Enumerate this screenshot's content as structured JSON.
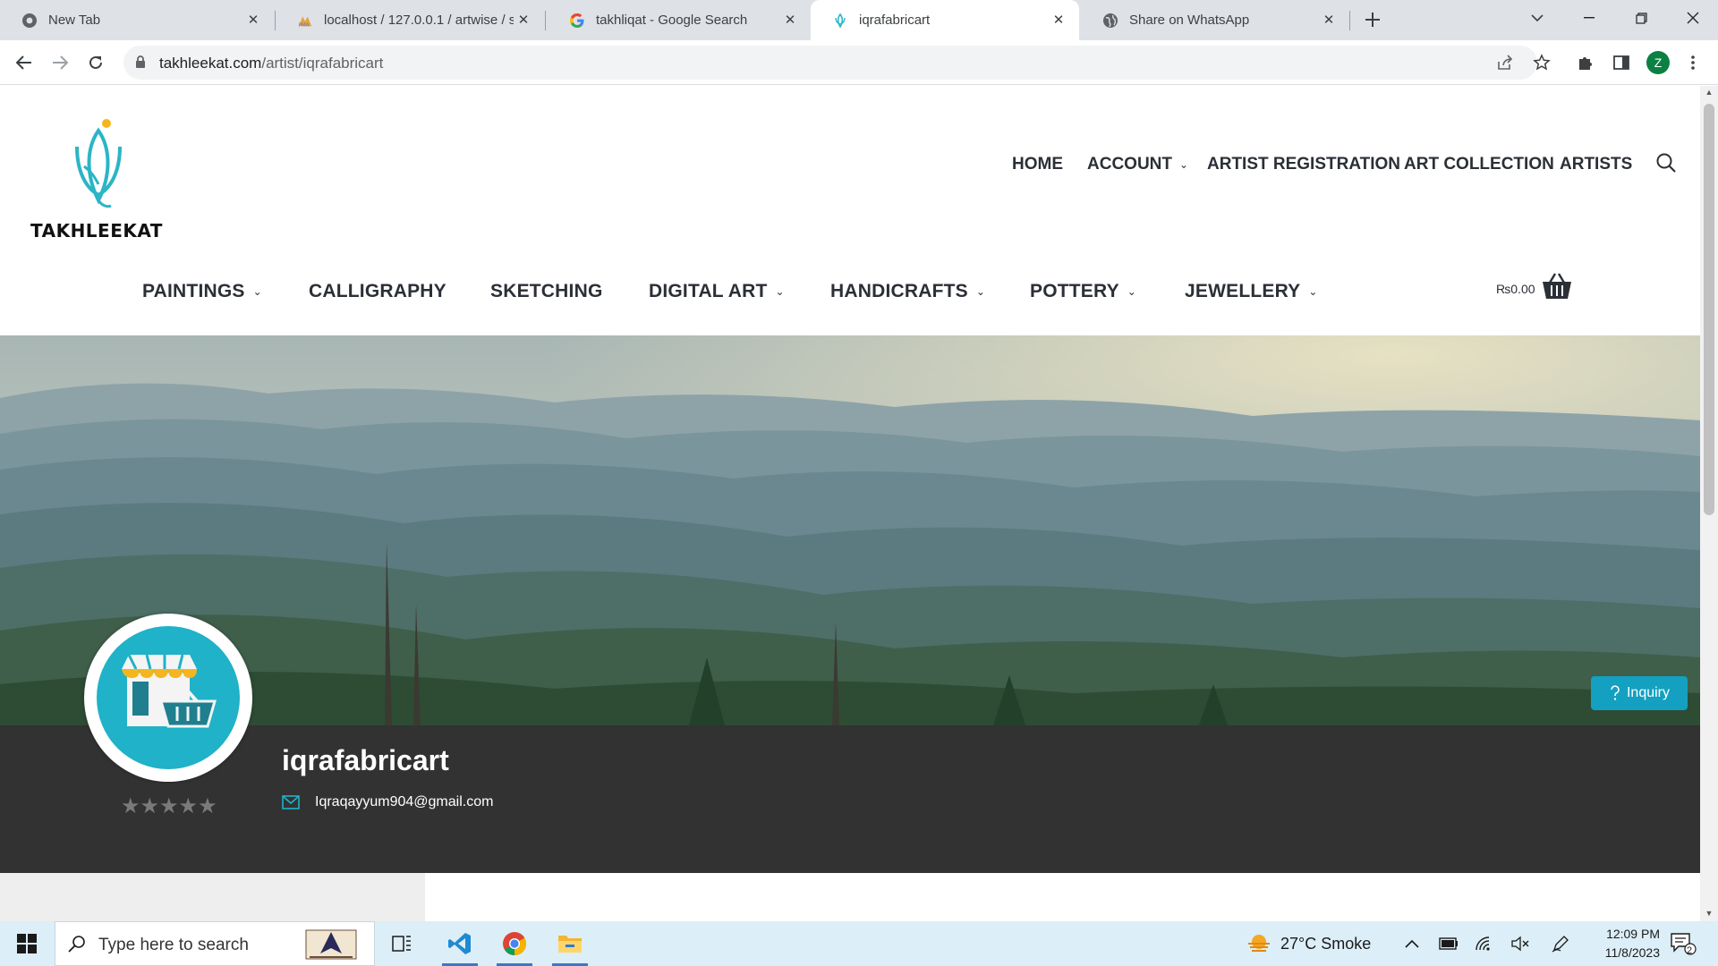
{
  "browser": {
    "tabs": [
      {
        "title": "New Tab",
        "icon": "chrome-icon"
      },
      {
        "title": "localhost / 127.0.0.1 / artwise / s",
        "icon": "phpmyadmin-icon"
      },
      {
        "title": "takhliqat - Google Search",
        "icon": "google-icon"
      },
      {
        "title": "iqrafabricart",
        "icon": "takhleekat-icon"
      },
      {
        "title": "Share on WhatsApp",
        "icon": "globe-icon"
      }
    ],
    "active_tab": 3,
    "url_domain": "takhleekat.com",
    "url_path": "/artist/iqrafabricart",
    "profile_initial": "Z"
  },
  "site": {
    "logo_text": "TAKHLEEKAT",
    "top_nav": [
      {
        "label": "HOME",
        "dropdown": false
      },
      {
        "label": "ACCOUNT",
        "dropdown": true
      },
      {
        "label": "ARTIST REGISTRATION",
        "dropdown": false
      },
      {
        "label": "ART COLLECTION",
        "dropdown": false
      },
      {
        "label": "ARTISTS",
        "dropdown": false
      }
    ],
    "categories": [
      {
        "label": "PAINTINGS",
        "dropdown": true
      },
      {
        "label": "CALLIGRAPHY",
        "dropdown": false
      },
      {
        "label": "SKETCHING",
        "dropdown": false
      },
      {
        "label": "DIGITAL ART",
        "dropdown": true
      },
      {
        "label": "HANDICRAFTS",
        "dropdown": true
      },
      {
        "label": "POTTERY",
        "dropdown": true
      },
      {
        "label": "JEWELLERY",
        "dropdown": true
      }
    ],
    "cart_total": "₨0.00"
  },
  "vendor": {
    "name": "iqrafabricart",
    "email": "Iqraqayyum904@gmail.com",
    "rating": 0,
    "rating_max": 5,
    "stars": "★★★★★",
    "inquiry_label": "Inquiry"
  },
  "taskbar": {
    "search_placeholder": "Type here to search",
    "weather": "27°C  Smoke",
    "time": "12:09 PM",
    "date": "11/8/2023",
    "notification_count": "2"
  },
  "colors": {
    "accent": "#1fb2c8",
    "inquiry": "#14a0c0",
    "infobar": "#323232"
  }
}
